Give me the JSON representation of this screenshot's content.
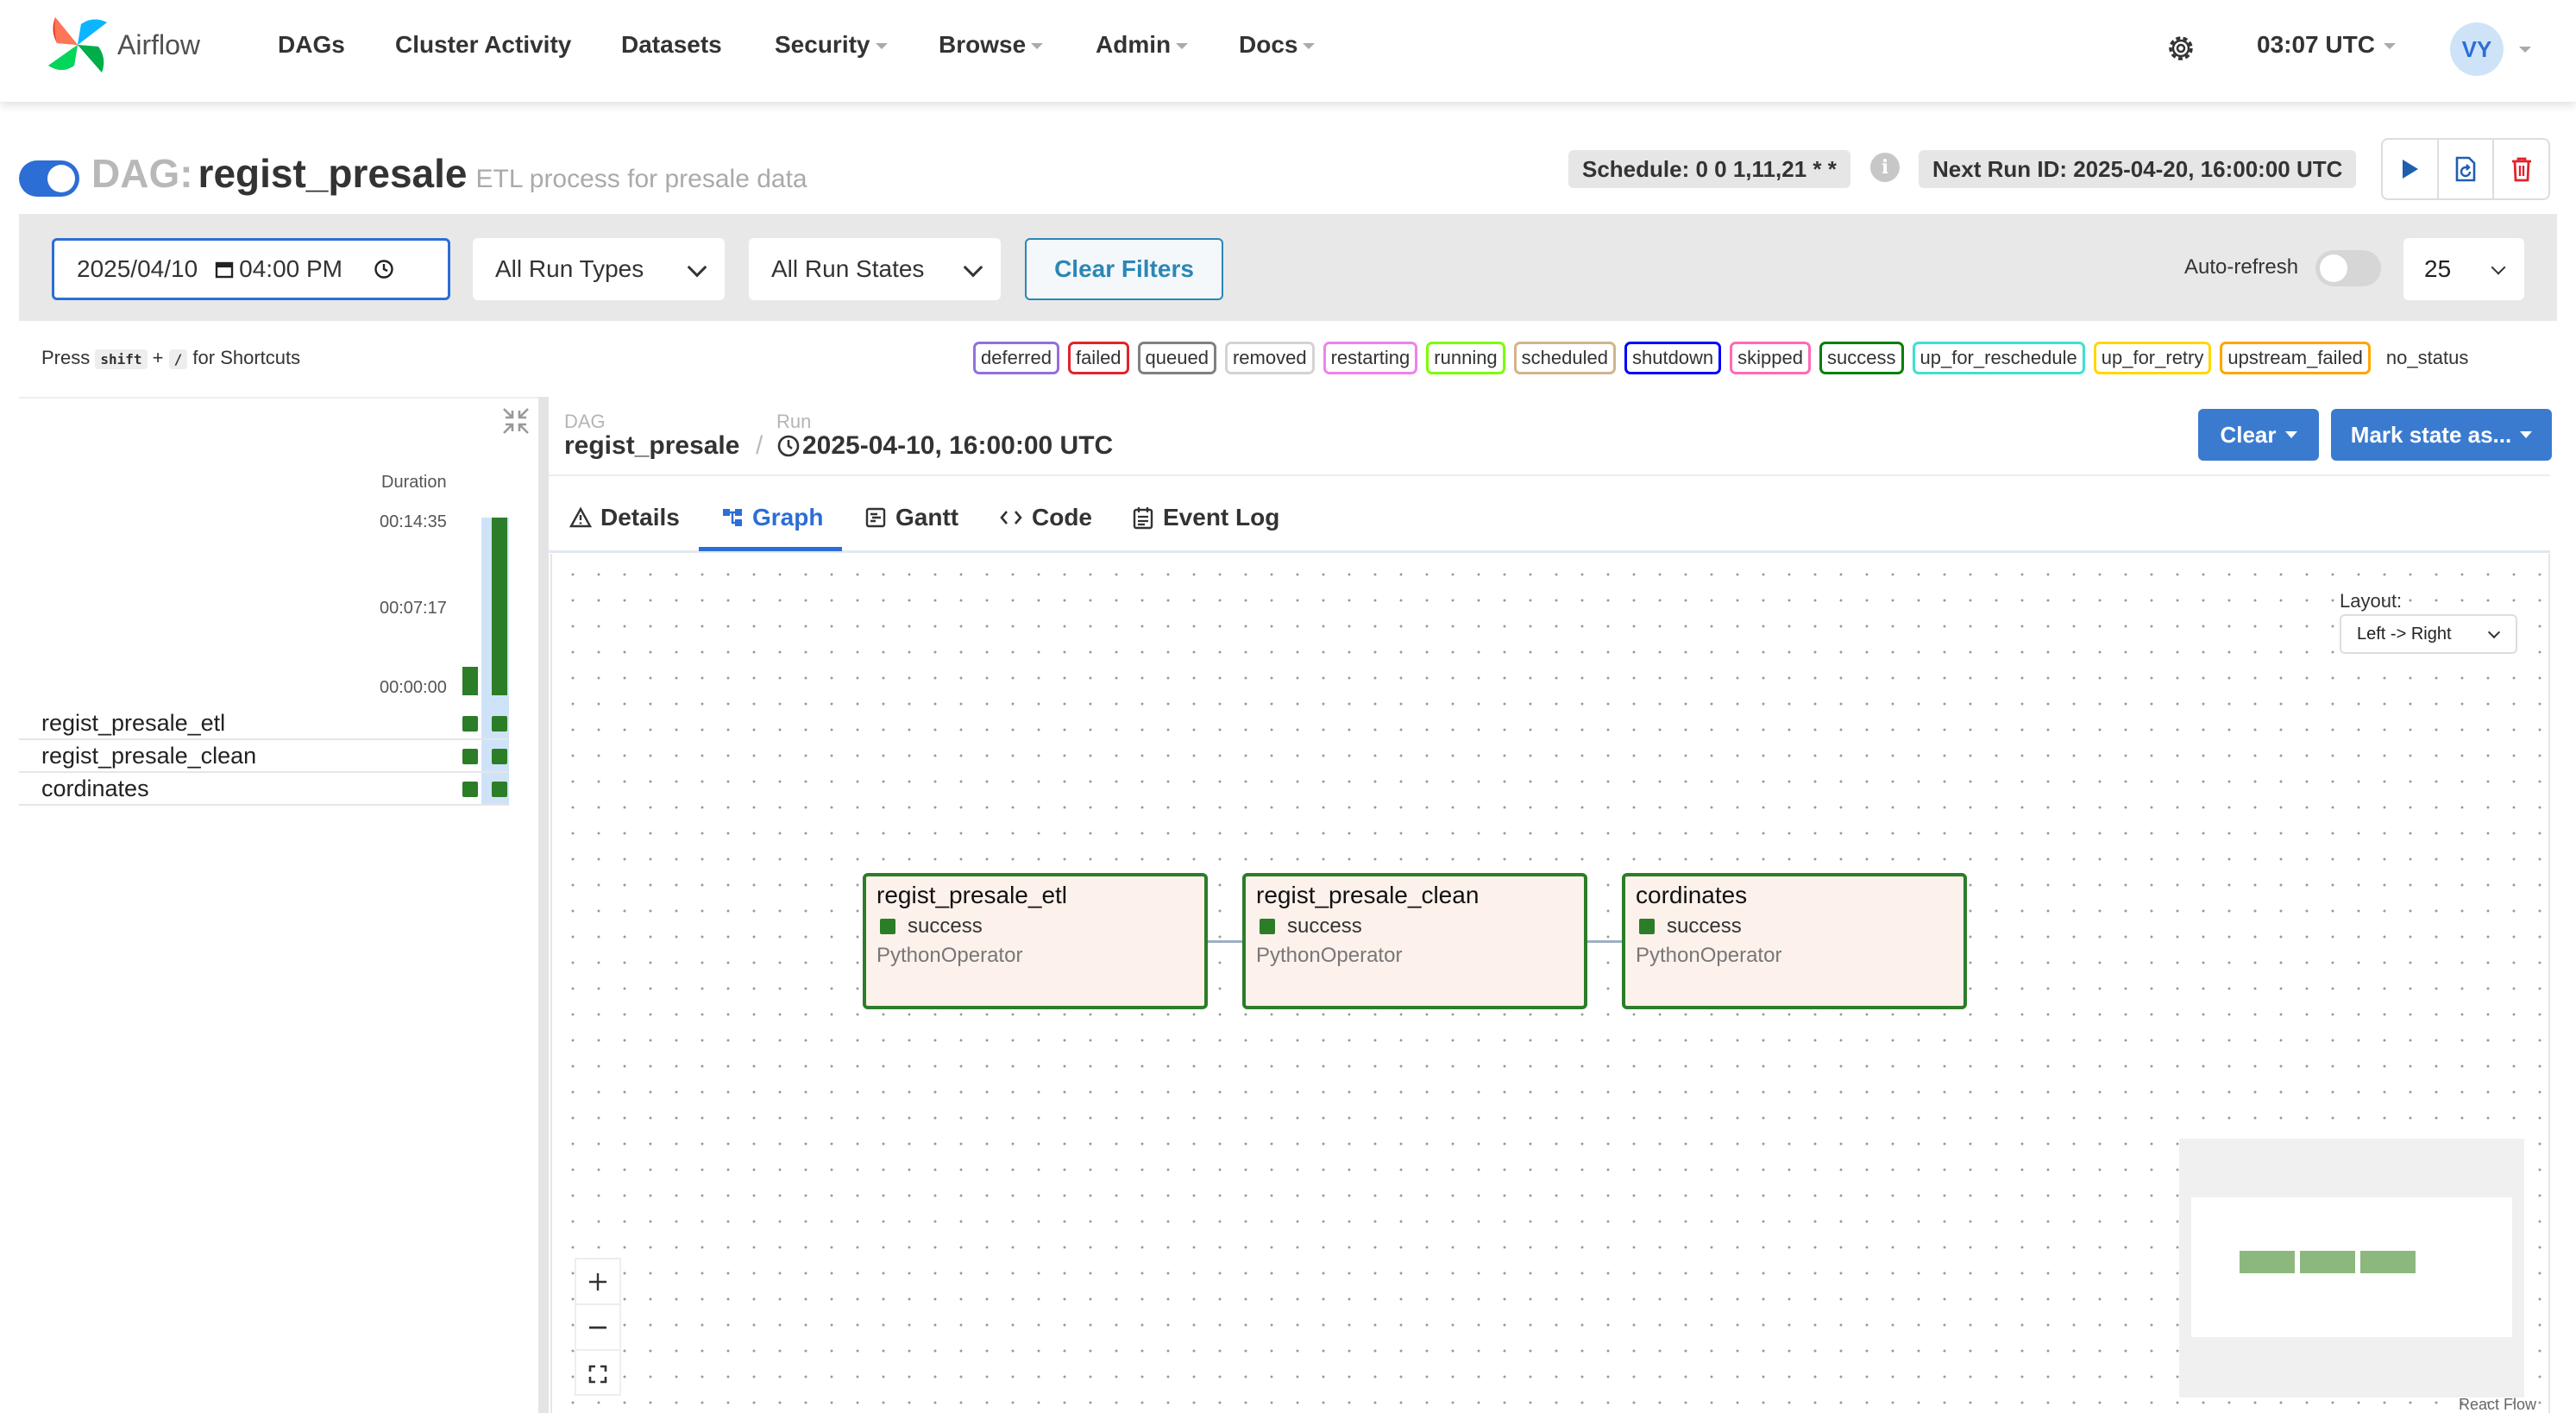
{
  "brand": {
    "name": "Airflow"
  },
  "nav": {
    "items": [
      {
        "label": "DAGs",
        "dropdown": false
      },
      {
        "label": "Cluster Activity",
        "dropdown": false
      },
      {
        "label": "Datasets",
        "dropdown": false
      },
      {
        "label": "Security",
        "dropdown": true
      },
      {
        "label": "Browse",
        "dropdown": true
      },
      {
        "label": "Admin",
        "dropdown": true
      },
      {
        "label": "Docs",
        "dropdown": true
      }
    ],
    "time": "03:07 UTC",
    "user_initials": "VY",
    "icons": [
      "gear-icon",
      "chevron-down-icon"
    ]
  },
  "dag": {
    "label": "DAG:",
    "name": "regist_presale",
    "description": "ETL process for presale data",
    "schedule": "Schedule: 0 0 1,11,21 * *",
    "next_run": "Next Run ID: 2025-04-20, 16:00:00 UTC",
    "paused": false
  },
  "filters": {
    "date_value": "2025/04/10",
    "time_value": "04:00 PM",
    "run_types": "All Run Types",
    "run_states": "All Run States",
    "clear_label": "Clear Filters",
    "autorefresh_label": "Auto-refresh",
    "autorefresh_on": false,
    "num_runs": "25"
  },
  "shortcuts": {
    "press": "Press",
    "key1": "shift",
    "plus": "+",
    "key2": "/",
    "suffix": "for Shortcuts"
  },
  "legend": [
    {
      "label": "deferred",
      "color": "#9370db"
    },
    {
      "label": "failed",
      "color": "#e0242d"
    },
    {
      "label": "queued",
      "color": "#808080"
    },
    {
      "label": "removed",
      "color": "#d3d3d3"
    },
    {
      "label": "restarting",
      "color": "#ee82ee"
    },
    {
      "label": "running",
      "color": "#7cfc00"
    },
    {
      "label": "scheduled",
      "color": "#d2b48c"
    },
    {
      "label": "shutdown",
      "color": "#0000ff"
    },
    {
      "label": "skipped",
      "color": "#ff69b4"
    },
    {
      "label": "success",
      "color": "#008000"
    },
    {
      "label": "up_for_reschedule",
      "color": "#40e0d0"
    },
    {
      "label": "up_for_retry",
      "color": "#ffd700"
    },
    {
      "label": "upstream_failed",
      "color": "#ffa500"
    },
    {
      "label": "no_status",
      "color": ""
    }
  ],
  "grid": {
    "duration_label": "Duration",
    "ticks": [
      "00:14:35",
      "00:07:17",
      "00:00:00"
    ],
    "run_durations_fraction": [
      0.16,
      1.0
    ],
    "tasks": [
      "regist_presale_etl",
      "regist_presale_clean",
      "cordinates"
    ]
  },
  "details": {
    "crumb_dag_label": "DAG",
    "crumb_dag": "regist_presale",
    "crumb_run_label": "Run",
    "crumb_sep": "/",
    "crumb_run": "2025-04-10, 16:00:00 UTC",
    "clear_button": "Clear",
    "mark_button": "Mark state as...",
    "tabs": [
      "Details",
      "Graph",
      "Gantt",
      "Code",
      "Event Log"
    ],
    "active_tab": "Graph"
  },
  "graph": {
    "layout_label": "Layout:",
    "layout_value": "Left -> Right",
    "nodes": [
      {
        "name": "regist_presale_etl",
        "state": "success",
        "operator": "PythonOperator"
      },
      {
        "name": "regist_presale_clean",
        "state": "success",
        "operator": "PythonOperator"
      },
      {
        "name": "cordinates",
        "state": "success",
        "operator": "PythonOperator"
      }
    ],
    "attribution": "React Flow"
  },
  "colors": {
    "accent": "#2c6ed5",
    "success": "#2c7d28",
    "button_blue": "#3a7bd0",
    "clear_filters": "#2b87b5"
  }
}
